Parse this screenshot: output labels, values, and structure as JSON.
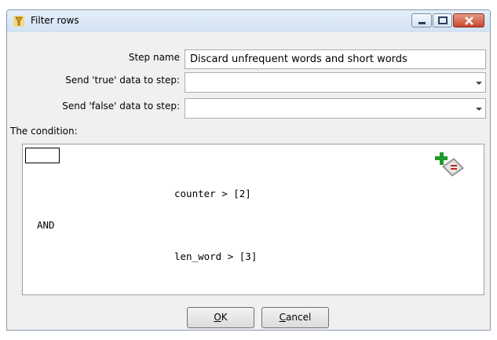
{
  "window": {
    "title": "Filter rows",
    "accent": "#c9462d"
  },
  "form": {
    "step_name_label": "Step name",
    "step_name_value": "Discard unfrequent words and short words",
    "true_label": "Send 'true' data to step:",
    "true_value": "",
    "false_label": "Send 'false' data to step:",
    "false_value": ""
  },
  "condition": {
    "heading": "The condition:",
    "expr1": "counter > [2]",
    "operator": "AND",
    "expr2": "len_word > [3]"
  },
  "buttons": {
    "ok_mnemonic": "O",
    "ok_rest": "K",
    "cancel_mnemonic": "C",
    "cancel_rest": "ancel"
  }
}
